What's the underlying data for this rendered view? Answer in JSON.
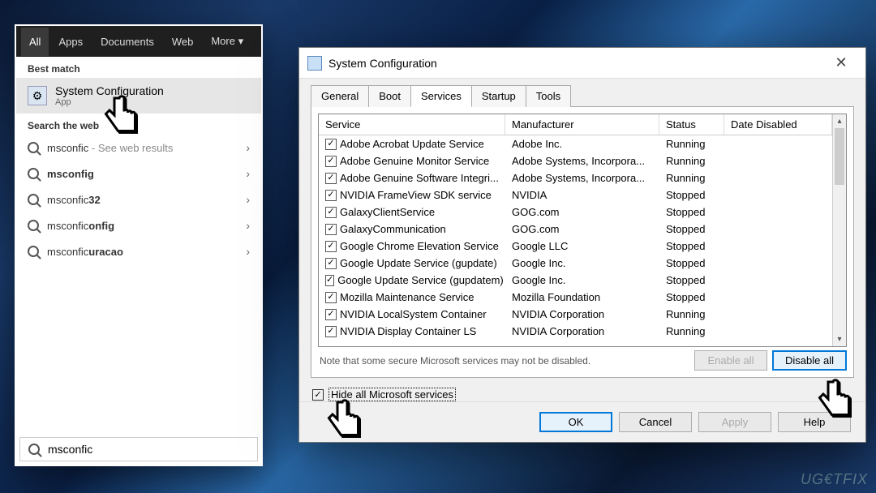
{
  "watermark": "UG€TFIX",
  "search": {
    "tabs": [
      "All",
      "Apps",
      "Documents",
      "Web",
      "More"
    ],
    "active_tab": 0,
    "best_match_label": "Best match",
    "best_match": {
      "title": "System Configuration",
      "subtitle": "App"
    },
    "search_web_label": "Search the web",
    "web_items": [
      {
        "prefix": "msconfic",
        "bold": "",
        "tail": " - See web results"
      },
      {
        "prefix": "",
        "bold": "msconfig",
        "tail": ""
      },
      {
        "prefix": "msconfic",
        "bold": "32",
        "tail": ""
      },
      {
        "prefix": "msconfic",
        "bold": "onfig",
        "tail": ""
      },
      {
        "prefix": "msconfic",
        "bold": "uracao",
        "tail": ""
      }
    ],
    "query": "msconfic"
  },
  "dialog": {
    "title": "System Configuration",
    "tabs": [
      "General",
      "Boot",
      "Services",
      "Startup",
      "Tools"
    ],
    "active_tab": 2,
    "columns": {
      "service": "Service",
      "manufacturer": "Manufacturer",
      "status": "Status",
      "dateDisabled": "Date Disabled"
    },
    "services": [
      {
        "name": "Adobe Acrobat Update Service",
        "mfr": "Adobe Inc.",
        "status": "Running"
      },
      {
        "name": "Adobe Genuine Monitor Service",
        "mfr": "Adobe Systems, Incorpora...",
        "status": "Running"
      },
      {
        "name": "Adobe Genuine Software Integri...",
        "mfr": "Adobe Systems, Incorpora...",
        "status": "Running"
      },
      {
        "name": "NVIDIA FrameView SDK service",
        "mfr": "NVIDIA",
        "status": "Stopped"
      },
      {
        "name": "GalaxyClientService",
        "mfr": "GOG.com",
        "status": "Stopped"
      },
      {
        "name": "GalaxyCommunication",
        "mfr": "GOG.com",
        "status": "Stopped"
      },
      {
        "name": "Google Chrome Elevation Service",
        "mfr": "Google LLC",
        "status": "Stopped"
      },
      {
        "name": "Google Update Service (gupdate)",
        "mfr": "Google Inc.",
        "status": "Stopped"
      },
      {
        "name": "Google Update Service (gupdatem)",
        "mfr": "Google Inc.",
        "status": "Stopped"
      },
      {
        "name": "Mozilla Maintenance Service",
        "mfr": "Mozilla Foundation",
        "status": "Stopped"
      },
      {
        "name": "NVIDIA LocalSystem Container",
        "mfr": "NVIDIA Corporation",
        "status": "Running"
      },
      {
        "name": "NVIDIA Display Container LS",
        "mfr": "NVIDIA Corporation",
        "status": "Running"
      }
    ],
    "note": "Note that some secure Microsoft services may not be disabled.",
    "enable_all": "Enable all",
    "disable_all": "Disable all",
    "hide_ms": "Hide all Microsoft services",
    "buttons": {
      "ok": "OK",
      "cancel": "Cancel",
      "apply": "Apply",
      "help": "Help"
    }
  }
}
